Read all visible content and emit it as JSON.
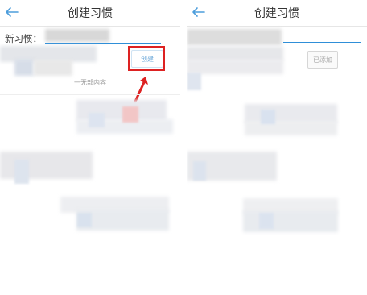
{
  "left_panel": {
    "title": "创建习惯",
    "new_habit_label": "新习惯：",
    "create_label": "创建",
    "empty_hint": "一无部内容"
  },
  "right_panel": {
    "title": "创建习惯",
    "added_label": "已添加"
  },
  "colors": {
    "accent": "#2f8fd8",
    "annotation": "#dd2222"
  },
  "icons": {
    "back": "arrow-left-icon",
    "pointer": "red-arrow-icon"
  }
}
